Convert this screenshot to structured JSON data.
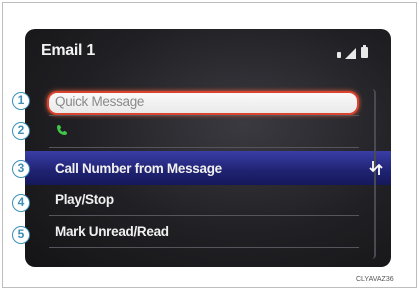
{
  "screen": {
    "title": "Email 1"
  },
  "menu": [
    {
      "label": "Quick Message"
    },
    {
      "label": ""
    },
    {
      "label": "Call Number from Message"
    },
    {
      "label": "Play/Stop"
    },
    {
      "label": "Mark Unread/Read"
    }
  ],
  "callouts": [
    "1",
    "2",
    "3",
    "4",
    "5"
  ],
  "icons": {
    "phone": "phone-icon",
    "return": "return-icon",
    "signal": "signal-icon",
    "battery": "battery-icon",
    "bluetooth": "bluetooth-icon"
  },
  "caption": "CLYAVAZ36",
  "colors": {
    "highlight_border": "#d8442e",
    "selected_row": "#1f2270",
    "callout": "#3c8fb6",
    "phone": "#3fc64a"
  }
}
